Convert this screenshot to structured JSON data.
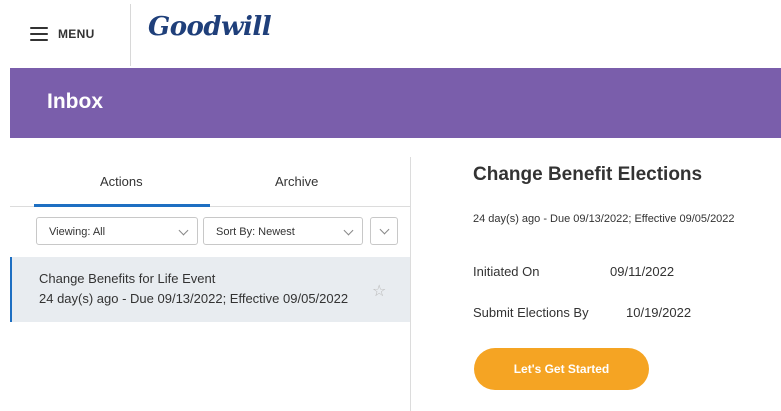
{
  "header": {
    "menu_label": "MENU",
    "logo_text": "Goodwill"
  },
  "banner": {
    "title": "Inbox",
    "color": "#7a5eab"
  },
  "tabs": [
    {
      "label": "Actions",
      "active": true
    },
    {
      "label": "Archive",
      "active": false
    }
  ],
  "filters": {
    "viewing": "Viewing: All",
    "sort": "Sort By: Newest"
  },
  "inbox_items": [
    {
      "title": "Change Benefits for Life Event",
      "subtitle": "24 day(s) ago - Due 09/13/2022; Effective 09/05/2022",
      "starred": false
    }
  ],
  "detail": {
    "title": "Change Benefit Elections",
    "subtitle": "24 day(s) ago - Due 09/13/2022; Effective 09/05/2022",
    "fields": [
      {
        "label": "Initiated On",
        "value": "09/11/2022"
      },
      {
        "label": "Submit Elections By",
        "value": "10/19/2022"
      }
    ],
    "cta_label": "Let's Get Started",
    "cta_color": "#f5a423"
  },
  "accent_color": "#1e6fc2"
}
